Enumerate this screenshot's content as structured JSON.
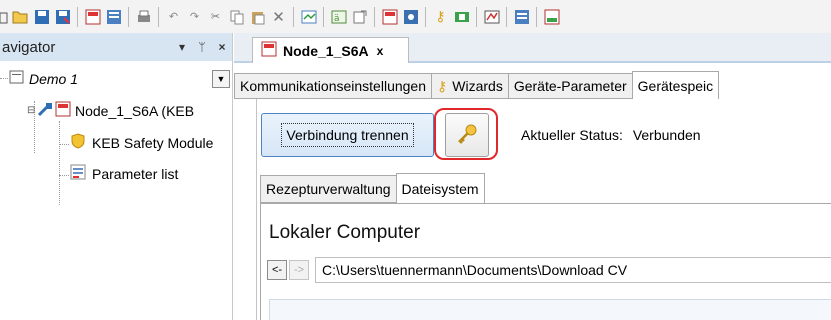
{
  "toolbar": {
    "icons": [
      "folder-partial-icon",
      "open-folder-icon",
      "save-icon",
      "save-as-icon",
      "keb-device-icon",
      "keb-list-icon",
      "print-icon",
      "undo-icon",
      "redo-icon",
      "cut-icon",
      "copy-icon",
      "paste-icon",
      "delete-icon",
      "properties-icon",
      "tools-icon",
      "export-icon",
      "keb-device-icon",
      "keb-network-icon",
      "wizard-key-icon",
      "download-icon",
      "scope-icon",
      "parameter-list-icon",
      "keb-node-icon"
    ]
  },
  "navigator": {
    "title": "avigator",
    "pin": "▾ ⊥ ×",
    "root_label": "Demo 1",
    "node_label": "Node_1_S6A (KEB",
    "children": [
      "KEB Safety Module",
      "Parameter list"
    ]
  },
  "document": {
    "tab_label": "Node_1_S6A",
    "close": "x"
  },
  "tabs_main": [
    {
      "label": "Kommunikationseinstellungen",
      "active": false
    },
    {
      "label": "Wizards",
      "active": false
    },
    {
      "label": "Geräte-Parameter",
      "active": false
    },
    {
      "label": "Gerätespeic",
      "active": true
    }
  ],
  "connection": {
    "disconnect_label": "Verbindung trennen",
    "status_label": "Aktueller Status:",
    "status_value": "Verbunden"
  },
  "tabs_sub": [
    {
      "label": "Rezepturverwaltung",
      "active": false
    },
    {
      "label": "Dateisystem",
      "active": true
    }
  ],
  "filesystem": {
    "local_title": "Lokaler Computer",
    "back": "<-",
    "forward": "->",
    "path": "C:\\Users\\tuennermann\\Documents\\Download CV"
  },
  "colors": {
    "nav_header": "#d7e4f2",
    "highlight": "#e0282c",
    "button_border": "#4f84c4"
  }
}
